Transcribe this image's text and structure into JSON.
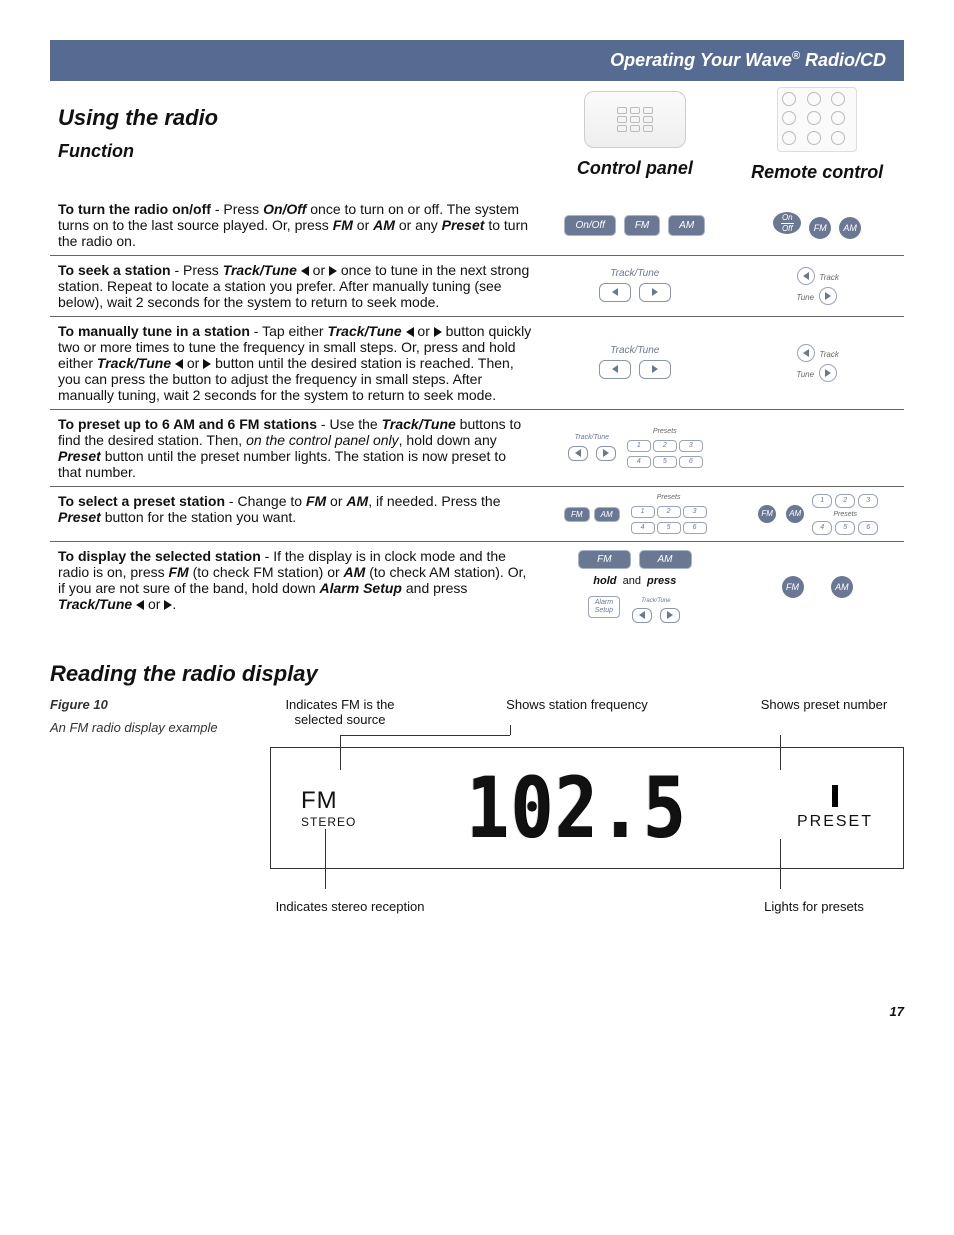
{
  "header": {
    "title_html": "Operating Your Wave® Radio/CD"
  },
  "section1_title": "Using the radio",
  "table_headers": {
    "function": "Function",
    "control_panel": "Control panel",
    "remote": "Remote control"
  },
  "rows": [
    {
      "lead": "To turn the radio on/off",
      "rest": " - Press <b><i>On/Off</i></b> once to turn on or off. The system turns on to the last source played. Or, press <b><i>FM</i></b> or <b><i>AM</i></b> or any <b><i>Preset</i></b> to turn the radio on.",
      "cp": {
        "type": "onoff"
      },
      "rc": {
        "type": "onoff"
      }
    },
    {
      "lead": "To seek a station",
      "rest": " - Press <b><i>Track/Tune</i></b> ◁ or ▷ once to tune in the next strong station. Repeat to locate a station you prefer. After manually tuning (see below), wait 2 seconds for the system to return to seek mode.",
      "cp": {
        "type": "tracktune"
      },
      "rc": {
        "type": "tracktune"
      }
    },
    {
      "lead": "To manually tune in a station",
      "rest": " - Tap either <b><i>Track/Tune</i></b> ◁ or ▷ button quickly two or more times to tune the frequency in small steps. Or, press and hold either <b><i>Track/Tune</i></b> ◁ or ▷ button until the desired station is reached. Then, you can press the button to adjust the frequency in small steps. After manually tuning, wait 2 seconds for the system to return to seek mode.",
      "cp": {
        "type": "tracktune"
      },
      "rc": {
        "type": "tracktune"
      }
    },
    {
      "lead": "To preset up to 6 AM and 6 FM stations",
      "rest": " - Use the <b><i>Track/Tune</i></b> buttons to find the desired station. Then, <i>on the control panel only</i>, hold down any <b><i>Preset</i></b> button until the preset number lights. The station is now preset to that number.",
      "cp": {
        "type": "tracktune_presets"
      },
      "rc": {
        "type": "none"
      }
    },
    {
      "lead": "To select a preset station",
      "rest": " - Change to <b><i>FM</i></b> or <b><i>AM</i></b>, if needed. Press the <b><i>Preset</i></b> button for the station you want.",
      "cp": {
        "type": "fmam_presets"
      },
      "rc": {
        "type": "fmam_presets"
      }
    },
    {
      "lead": "To display the selected station",
      "rest": " - If the display is in clock mode and the radio is on, press <b><i>FM</i></b> (to check FM station) or <b><i>AM</i></b> (to check AM station). Or, if you are not sure of the band, hold down <b><i>Alarm Setup</i></b> and press <b><i>Track/Tune</i></b> ◁ or ▷.",
      "cp": {
        "type": "display_station"
      },
      "rc": {
        "type": "fmam"
      },
      "no_border": true
    }
  ],
  "section2_title": "Reading the radio display",
  "figure": {
    "label": "Figure 10",
    "caption": "An FM radio display example",
    "callouts_top": [
      "Indicates FM is the selected source",
      "Shows station frequency",
      "Shows preset number"
    ],
    "callouts_bot": [
      "Indicates stereo reception",
      "Lights for presets"
    ],
    "lcd": {
      "fm": "FM",
      "stereo": "STEREO",
      "freq": "102.5",
      "preset": "PRESET"
    }
  },
  "page_number": "17",
  "labels": {
    "onoff": "On/Off",
    "fm": "FM",
    "am": "AM",
    "tracktune": "Track/Tune",
    "track": "Track",
    "tune": "Tune",
    "on": "On",
    "off": "Off",
    "presets": "Presets",
    "hold": "hold",
    "and": "and",
    "press": "press",
    "alarm_setup": "Alarm Setup"
  }
}
